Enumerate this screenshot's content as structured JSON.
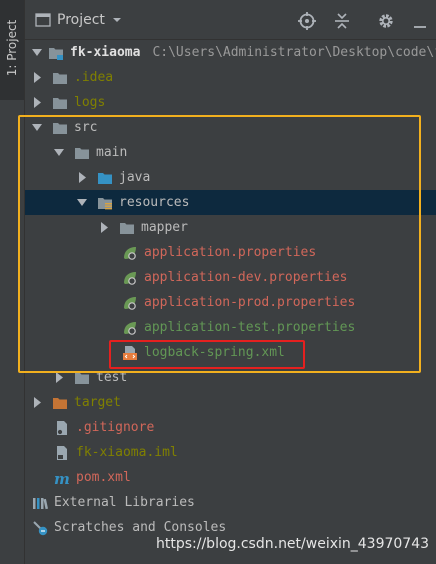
{
  "side_tab": {
    "label": "1: Project"
  },
  "toolbar": {
    "title": "Project",
    "icons": [
      "chevron-down-icon",
      "locate-icon",
      "collapse-all-icon",
      "gear-icon",
      "hide-icon"
    ]
  },
  "tree": {
    "root": {
      "name": "fk-xiaoma",
      "path": "C:\\Users\\Administrator\\Desktop\\code\\f"
    },
    "idea": ".idea",
    "logs": "logs",
    "src": "src",
    "main": "main",
    "java": "java",
    "resources": "resources",
    "mapper": "mapper",
    "files": [
      "application.properties",
      "application-dev.properties",
      "application-prod.properties",
      "application-test.properties",
      "logback-spring.xml"
    ],
    "test": "test",
    "target": "target",
    "gitignore": ".gitignore",
    "iml": "fk-xiaoma.iml",
    "pom": "pom.xml",
    "external_libraries": "External Libraries",
    "scratches": "Scratches and Consoles"
  },
  "colors": {
    "background": "#3c3f41",
    "selection": "#0d293e",
    "highlight_box_outer": "#f2b01e",
    "highlight_box_inner": "#e5201f",
    "untracked_file": "#d1675a",
    "added_file": "#629755",
    "ignored_file": "#808000"
  },
  "watermark": "https://blog.csdn.net/weixin_43970743"
}
